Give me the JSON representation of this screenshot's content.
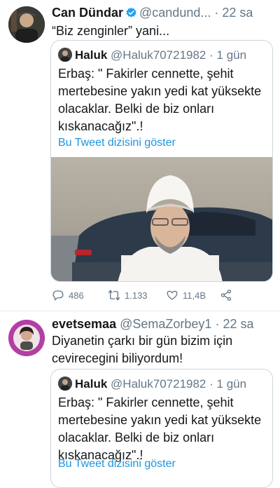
{
  "tweet1": {
    "name": "Can Dündar",
    "handle": "@candund...",
    "separator": "·",
    "time": "22 sa",
    "text": "“Biz zenginler” yani...",
    "quote": {
      "name": "Haluk",
      "handle": "@Haluk70721982",
      "separator": "·",
      "time": "1 gün",
      "text": "Erbaş: \" Fakirler cennette, şehit mertebesine yakın yedi kat yüksekte olacaklar. Belki de biz onları kıskanacağız\".!",
      "show_thread": "Bu Tweet dizisini göster"
    },
    "actions": {
      "replies": "486",
      "retweets": "1.133",
      "likes": "11,4B"
    }
  },
  "tweet2": {
    "name": "evetsemaa",
    "handle": "@SemaZorbey1",
    "separator": "·",
    "time": "22 sa",
    "text": "Diyanetin çarkı bir gün bizim için cevirecegini biliyordum!",
    "quote": {
      "name": "Haluk",
      "handle": "@Haluk70721982",
      "separator": "·",
      "time": "1 gün",
      "text": "Erbaş: \" Fakirler cennette, şehit mertebesine yakın yedi kat yüksekte olacaklar. Belki de biz onları kıskanacağız\".!",
      "show_thread": "Bu Tweet dizisini göster"
    }
  },
  "colors": {
    "text": "#14171a",
    "secondary": "#657786",
    "link": "#1b95e0",
    "verified": "#1da1f2",
    "border": "#ccd6dd"
  },
  "icons": [
    "verified-badge-icon",
    "reply-icon",
    "retweet-icon",
    "like-icon",
    "share-icon"
  ]
}
